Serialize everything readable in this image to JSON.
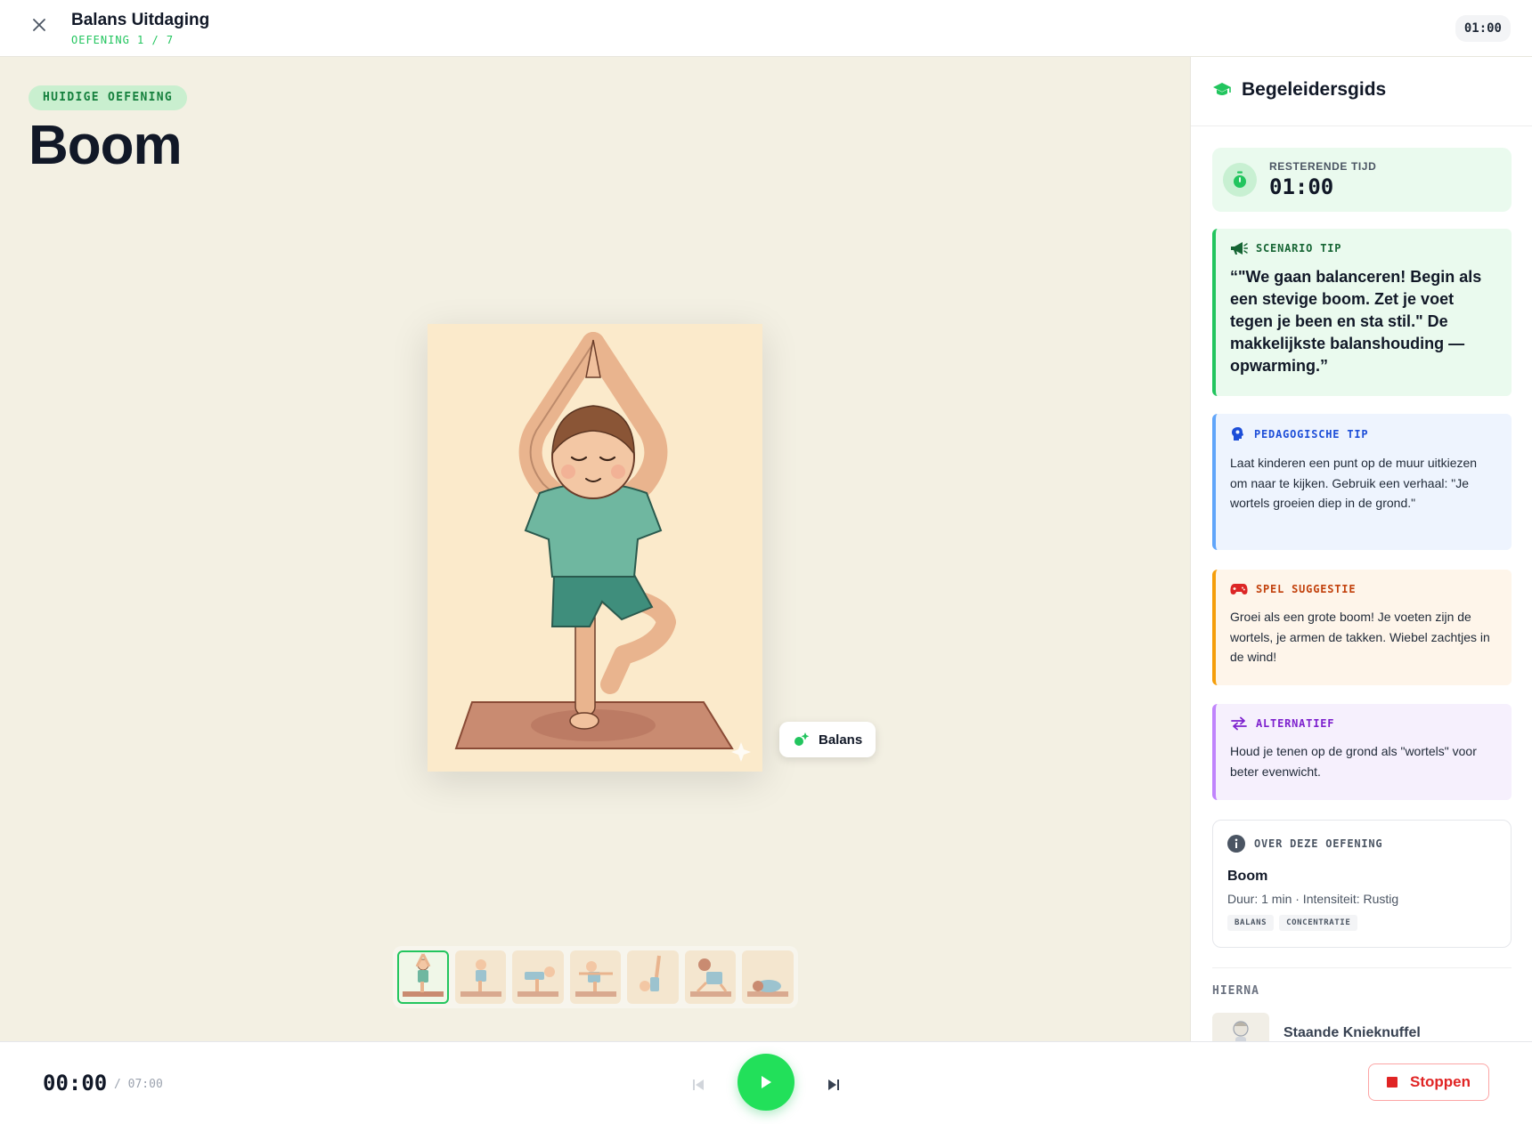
{
  "header": {
    "title": "Balans Uitdaging",
    "subtitle": "OEFENING 1 / 7",
    "timer": "01:00"
  },
  "stage": {
    "badge": "HUIDIGE OEFENING",
    "exercise_title": "Boom",
    "category_tag": "Balans",
    "thumbnails_count": 7,
    "active_thumbnail": 1
  },
  "player": {
    "elapsed": "00:00",
    "total": "/ 07:00",
    "stop_label": "Stoppen"
  },
  "panel": {
    "title": "Begeleidersgids",
    "time_label": "RESTERENDE TIJD",
    "time_value": "01:00",
    "scenario": {
      "label": "SCENARIO TIP",
      "text": "“\"We gaan balanceren! Begin als een stevige boom. Zet je voet tegen je been en sta stil.\" De makkelijkste balanshouding — opwarming.”"
    },
    "pedagogic": {
      "label": "PEDAGOGISCHE TIP",
      "text": "Laat kinderen een punt op de muur uitkiezen om naar te kijken. Gebruik een verhaal: \"Je wortels groeien diep in de grond.\""
    },
    "game": {
      "label": "SPEL SUGGESTIE",
      "text": "Groei als een grote boom! Je voeten zijn de wortels, je armen de takken. Wiebel zachtjes in de wind!"
    },
    "alternative": {
      "label": "ALTERNATIEF",
      "text": "Houd je tenen op de grond als \"wortels\" voor beter evenwicht."
    },
    "about": {
      "label": "OVER DEZE OEFENING",
      "name": "Boom",
      "meta": "Duur: 1 min · Intensiteit: Rustig",
      "tags": [
        "BALANS",
        "CONCENTRATIE"
      ]
    },
    "next_label": "HIERNA",
    "next_exercise": "Staande Knieknuffel"
  },
  "colors": {
    "accent_green": "#22c55e",
    "play_green": "#22e05a",
    "stop_red": "#e02424",
    "stage_bg": "#f3f0e3"
  },
  "icons": {
    "close": "close-icon",
    "panel": "graduation-cap-icon",
    "timer": "stopwatch-icon",
    "scenario": "megaphone-icon",
    "pedagogic": "brain-icon",
    "game": "gamepad-icon",
    "alternative": "swap-arrows-icon",
    "about": "info-icon",
    "tag": "sparkle-icon",
    "prev": "skip-previous-icon",
    "play": "play-icon",
    "next": "skip-next-icon",
    "stop": "stop-icon"
  }
}
